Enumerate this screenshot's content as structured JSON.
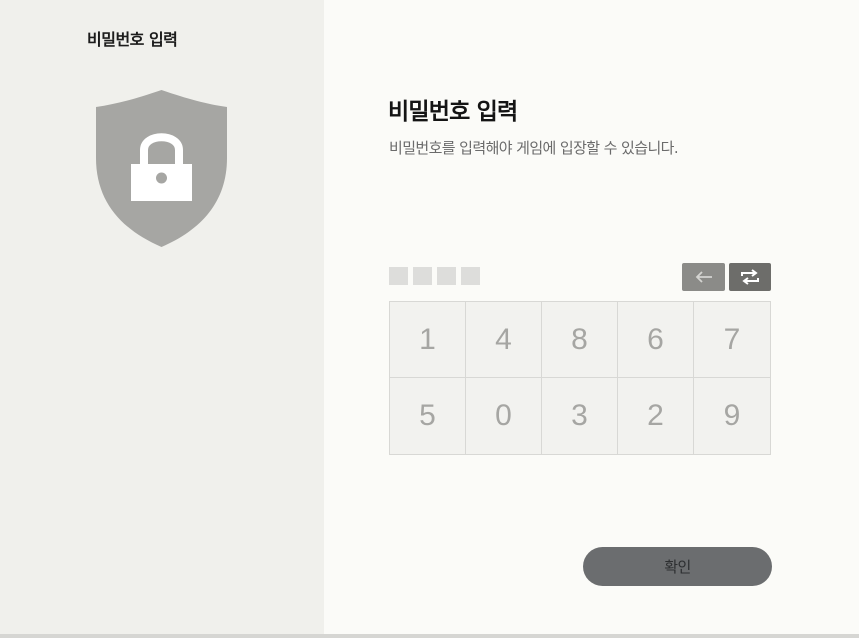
{
  "sidebar": {
    "title": "비밀번호 입력",
    "icon": "shield-lock-icon"
  },
  "main": {
    "title": "비밀번호 입력",
    "description": "비밀번호를 입력해야 게임에 입장할 수 있습니다."
  },
  "pin": {
    "entered_count": 0,
    "max_length": 4
  },
  "controls": {
    "backspace_icon": "arrow-left-icon",
    "shuffle_icon": "refresh-icon"
  },
  "keypad": {
    "keys": [
      "1",
      "4",
      "8",
      "6",
      "7",
      "5",
      "0",
      "3",
      "2",
      "9"
    ]
  },
  "confirm_label": "확인",
  "colors": {
    "left_panel": "#f0f0ec",
    "right_panel": "#fbfbf8",
    "shield": "#a6a6a3",
    "confirm_button": "#6b6d6f"
  }
}
